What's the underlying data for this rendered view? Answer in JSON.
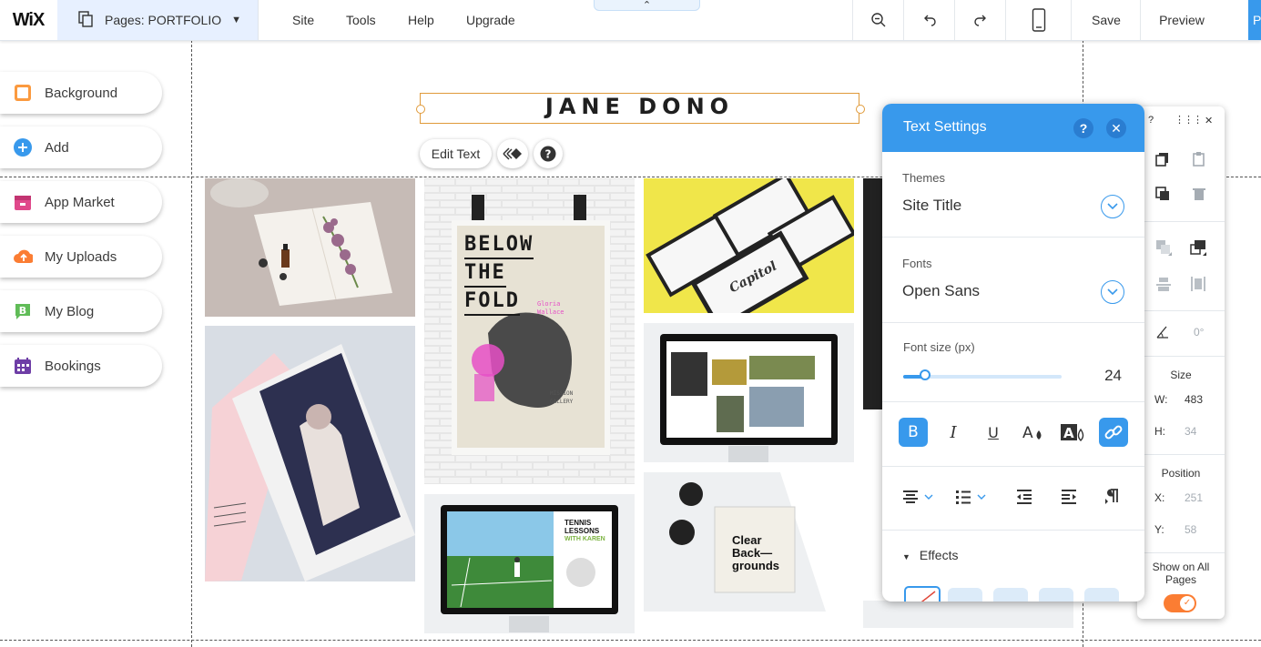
{
  "topbar": {
    "logo": "WiX",
    "pages_label": "Pages: PORTFOLIO",
    "menu": [
      "Site",
      "Tools",
      "Help",
      "Upgrade"
    ],
    "save": "Save",
    "preview": "Preview",
    "publish": "Pub"
  },
  "panel": {
    "items": [
      {
        "label": "Background",
        "icon": "background-icon",
        "color": "#fb9a3f"
      },
      {
        "label": "Add",
        "icon": "add-icon",
        "color": "#3899ec"
      },
      {
        "label": "App Market",
        "icon": "app-market-icon",
        "color": "#e0498b"
      },
      {
        "label": "My Uploads",
        "icon": "upload-icon",
        "color": "#fb7d33"
      },
      {
        "label": "My Blog",
        "icon": "blog-icon",
        "color": "#60bc57"
      },
      {
        "label": "Bookings",
        "icon": "bookings-icon",
        "color": "#6e3ea6"
      }
    ]
  },
  "canvas": {
    "site_title": "JANE DONO",
    "edit_text": "Edit Text",
    "images": {
      "poster_lines": [
        "BELOW",
        "THE",
        "FOLD"
      ],
      "poster_author": "Gloria Wallace",
      "poster_footer": "MISSION GALLERY",
      "card_brand": "Capitol",
      "tennis_title": "TENNIS LESSONS",
      "tennis_sub": "WITH KAREN",
      "cd_title": "Clear Back— grounds"
    }
  },
  "text_settings": {
    "title": "Text Settings",
    "themes_label": "Themes",
    "themes_value": "Site Title",
    "fonts_label": "Fonts",
    "fonts_value": "Open Sans",
    "size_label": "Font size (px)",
    "size_value": "24",
    "size_fraction": 0.14,
    "effects_label": "Effects"
  },
  "right_toolbar": {
    "rotation": "0°",
    "size_label": "Size",
    "w_label": "W:",
    "w_value": "483",
    "h_label": "H:",
    "h_value": "34",
    "position_label": "Position",
    "x_label": "X:",
    "x_value": "251",
    "y_label": "Y:",
    "y_value": "58",
    "show_all": "Show on All Pages"
  },
  "colors": {
    "accent": "#3899ec",
    "selection": "#e09a3a",
    "toggle": "#fb7d33"
  }
}
